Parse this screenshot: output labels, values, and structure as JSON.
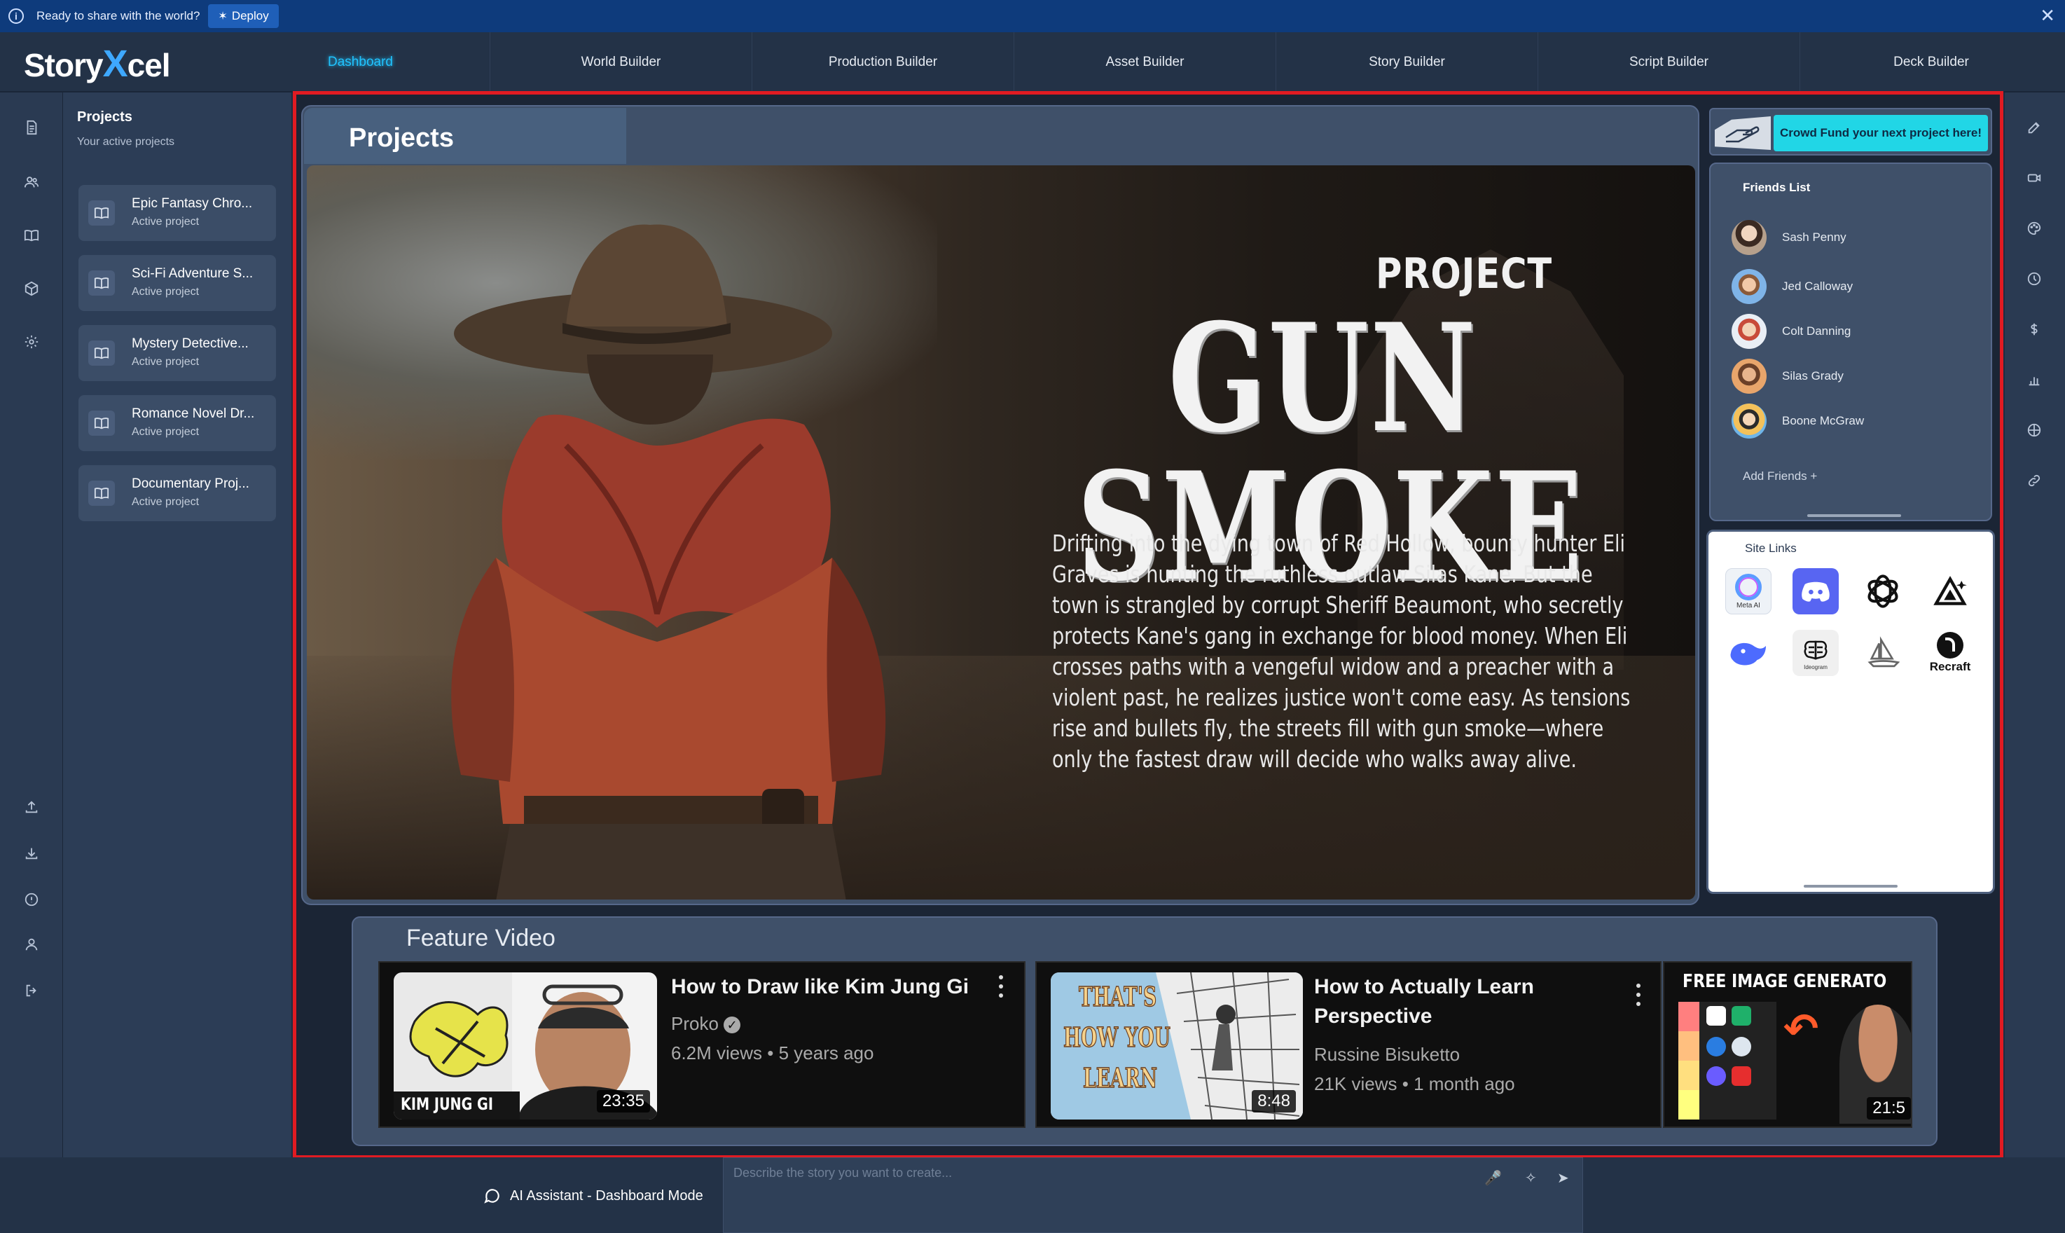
{
  "banner": {
    "message": "Ready to share with the world?",
    "deploy_label": "Deploy"
  },
  "app": {
    "logo_pre": "Story",
    "logo_x": "X",
    "logo_post": "cel"
  },
  "nav": {
    "tabs": [
      "Dashboard",
      "World Builder",
      "Production Builder",
      "Asset Builder",
      "Story Builder",
      "Script Builder",
      "Deck Builder"
    ],
    "active": "Dashboard"
  },
  "sidebar": {
    "title": "Projects",
    "subtitle": "Your active projects",
    "projects": [
      {
        "name": "Epic Fantasy Chro...",
        "status": "Active project"
      },
      {
        "name": "Sci-Fi Adventure S...",
        "status": "Active project"
      },
      {
        "name": "Mystery Detective...",
        "status": "Active project"
      },
      {
        "name": "Romance Novel Dr...",
        "status": "Active project"
      },
      {
        "name": "Documentary Proj...",
        "status": "Active project"
      }
    ]
  },
  "projects_panel": {
    "title": "Projects",
    "hero": {
      "pre_title": "PROJECT",
      "title": "GUN SMOKE",
      "synopsis": "Drifting into the dying town of Red Hollow, bounty hunter Eli Graves is hunting the ruthless outlaw Silas Kane. But the town is strangled by corrupt Sheriff Beaumont, who secretly protects Kane's gang in exchange for blood money. When Eli crosses paths with a vengeful widow and a preacher with a violent past, he realizes justice won't come easy. As tensions rise and bullets fly, the streets fill with gun smoke—where only the fastest draw will decide who walks away alive."
    }
  },
  "crowdfund": {
    "label": "Crowd Fund your next project here!"
  },
  "friends": {
    "title": "Friends List",
    "list": [
      {
        "name": "Sash Penny",
        "color": "#c9b8a6"
      },
      {
        "name": "Jed Calloway",
        "color": "#7fb4e8"
      },
      {
        "name": "Colt Danning",
        "color": "#e6a39a"
      },
      {
        "name": "Silas Grady",
        "color": "#e8a56b"
      },
      {
        "name": "Boone McGraw",
        "color": "#f4c15a"
      }
    ],
    "add_label": "Add Friends +"
  },
  "site_links": {
    "title": "Site Links",
    "meta_label": "Meta AI",
    "ideogram_label": "Ideogram",
    "recraft_label": "Recraft"
  },
  "feature": {
    "title": "Feature Video",
    "videos": [
      {
        "title": "How to Draw like Kim Jung Gi",
        "channel": "Proko",
        "views": "6.2M views",
        "age": "5 years ago",
        "duration": "23:35",
        "thumb_caption": "KIM JUNG GI"
      },
      {
        "title_line1": "How to Actually Learn",
        "title_line2": "Perspective",
        "channel": "Russine Bisuketto",
        "views": "21K views",
        "age": "1 month ago",
        "duration": "8:48",
        "thumb_caption_1": "THAT'S",
        "thumb_caption_2": "HOW YOU",
        "thumb_caption_3": "LEARN"
      },
      {
        "title": "FREE IMAGE GENERATO",
        "duration": "21:5"
      }
    ]
  },
  "assistant": {
    "label": "AI Assistant - Dashboard Mode",
    "placeholder": "Describe the story you want to create..."
  }
}
